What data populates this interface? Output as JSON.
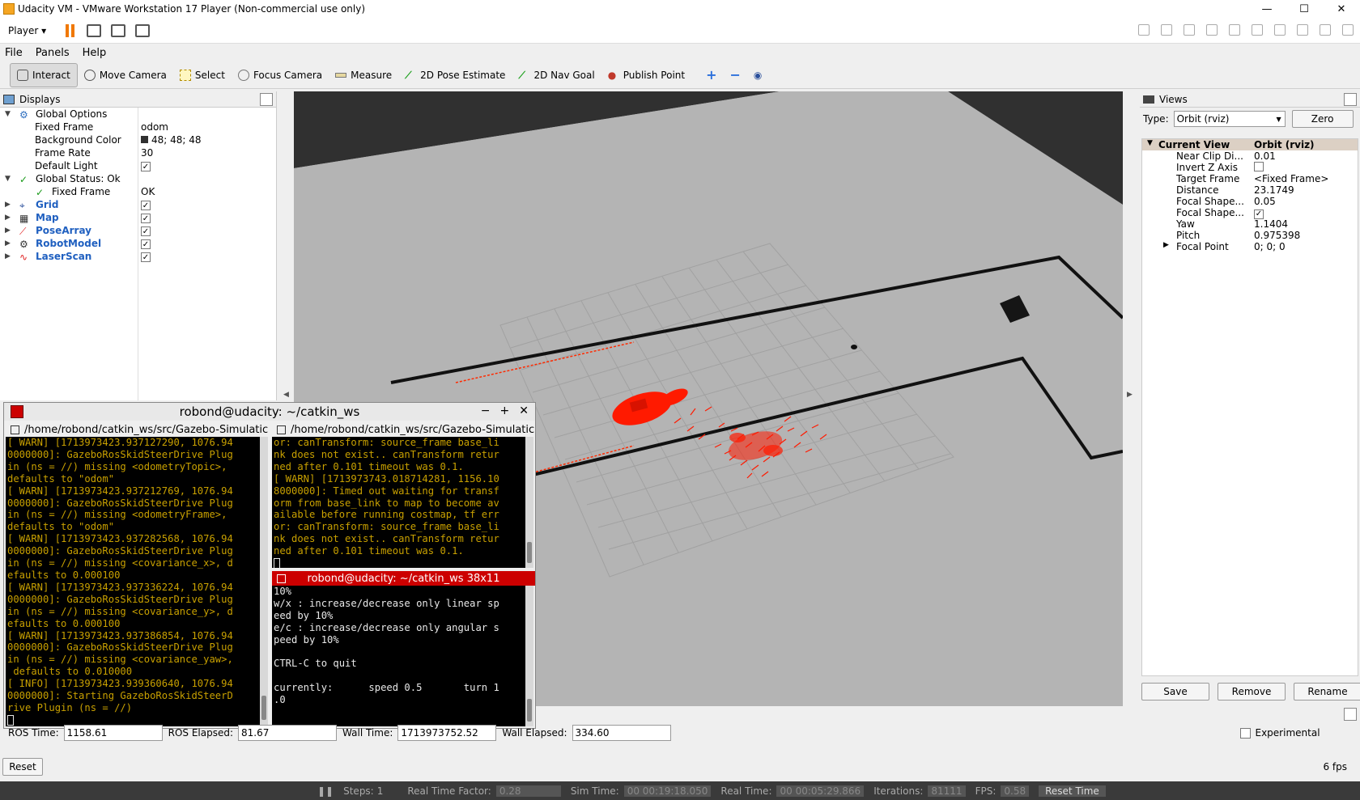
{
  "window": {
    "title": "Udacity VM - VMware Workstation 17 Player (Non-commercial use only)",
    "minimize": "—",
    "maximize": "☐",
    "close": "✕"
  },
  "vm_toolbar": {
    "player_label": "Player ▾"
  },
  "menubar": {
    "file": "File",
    "panels": "Panels",
    "help": "Help"
  },
  "tools": {
    "interact": "Interact",
    "move_camera": "Move Camera",
    "select": "Select",
    "focus_camera": "Focus Camera",
    "measure": "Measure",
    "pose_estimate": "2D Pose Estimate",
    "nav_goal": "2D Nav Goal",
    "publish_point": "Publish Point"
  },
  "displays": {
    "title": "Displays",
    "rows": [
      {
        "name": "Global Options",
        "value": ""
      },
      {
        "name": "Fixed Frame",
        "value": "odom"
      },
      {
        "name": "Background Color",
        "value": "48; 48; 48"
      },
      {
        "name": "Frame Rate",
        "value": "30"
      },
      {
        "name": "Default Light",
        "value": "✓"
      },
      {
        "name": "Global Status: Ok",
        "value": ""
      },
      {
        "name": "Fixed Frame",
        "value": "OK"
      },
      {
        "name": "Grid",
        "value": "✓"
      },
      {
        "name": "Map",
        "value": "✓"
      },
      {
        "name": "PoseArray",
        "value": "✓"
      },
      {
        "name": "RobotModel",
        "value": "✓"
      },
      {
        "name": "LaserScan",
        "value": "✓"
      }
    ]
  },
  "views": {
    "title": "Views",
    "type_label": "Type:",
    "type_value": "Orbit (rviz)",
    "zero_label": "Zero",
    "header_name": "Current View",
    "header_value": "Orbit (rviz)",
    "rows": [
      {
        "name": "Near Clip Di...",
        "value": "0.01"
      },
      {
        "name": "Invert Z Axis",
        "value": ""
      },
      {
        "name": "Target Frame",
        "value": "<Fixed Frame>"
      },
      {
        "name": "Distance",
        "value": "23.1749"
      },
      {
        "name": "Focal Shape...",
        "value": "0.05"
      },
      {
        "name": "Focal Shape...",
        "value": "✓"
      },
      {
        "name": "Yaw",
        "value": "1.1404"
      },
      {
        "name": "Pitch",
        "value": "0.975398"
      },
      {
        "name": "Focal Point",
        "value": "0; 0; 0"
      }
    ],
    "save": "Save",
    "remove": "Remove",
    "rename": "Rename"
  },
  "terminal": {
    "title": "robond@udacity: ~/catkin_ws",
    "left_tab": "/home/robond/catkin_ws/src/Gazebo-Simulatic",
    "right_tab": "/home/robond/catkin_ws/src/Gazebo-Simulatic",
    "left_lines": [
      "[ WARN] [1713973423.937127290, 1076.94",
      "0000000]: GazeboRosSkidSteerDrive Plug",
      "in (ns = //) missing <odometryTopic>,",
      "defaults to \"odom\"",
      "[ WARN] [1713973423.937212769, 1076.94",
      "0000000]: GazeboRosSkidSteerDrive Plug",
      "in (ns = //) missing <odometryFrame>,",
      "defaults to \"odom\"",
      "[ WARN] [1713973423.937282568, 1076.94",
      "0000000]: GazeboRosSkidSteerDrive Plug",
      "in (ns = //) missing <covariance_x>, d",
      "efaults to 0.000100",
      "[ WARN] [1713973423.937336224, 1076.94",
      "0000000]: GazeboRosSkidSteerDrive Plug",
      "in (ns = //) missing <covariance_y>, d",
      "efaults to 0.000100",
      "[ WARN] [1713973423.937386854, 1076.94",
      "0000000]: GazeboRosSkidSteerDrive Plug",
      "in (ns = //) missing <covariance_yaw>,",
      " defaults to 0.010000"
    ],
    "left_info_lines": [
      "[ INFO] [1713973423.939360640, 1076.94",
      "0000000]: Starting GazeboRosSkidSteerD",
      "rive Plugin (ns = //)"
    ],
    "right_top_lines": [
      "or: canTransform: source_frame base_li",
      "nk does not exist.. canTransform retur",
      "ned after 0.101 timeout was 0.1.",
      "[ WARN] [1713973743.018714281, 1156.10",
      "8000000]: Timed out waiting for transf",
      "orm from base_link to map to become av",
      "ailable before running costmap, tf err",
      "or: canTransform: source_frame base_li",
      "nk does not exist.. canTransform retur",
      "ned after 0.101 timeout was 0.1."
    ],
    "teleop_title": "robond@udacity: ~/catkin_ws 38x11",
    "right_bottom_lines": [
      "10%",
      "w/x : increase/decrease only linear sp",
      "eed by 10%",
      "e/c : increase/decrease only angular s",
      "peed by 10%",
      "",
      "CTRL-C to quit",
      "",
      "currently:      speed 0.5       turn 1",
      ".0"
    ]
  },
  "timebar": {
    "ros_time_label": "ROS Time:",
    "ros_time": "1158.61",
    "ros_elapsed_label": "ROS Elapsed:",
    "ros_elapsed": "81.67",
    "wall_time_label": "Wall Time:",
    "wall_time": "1713973752.52",
    "wall_elapsed_label": "Wall Elapsed:",
    "wall_elapsed": "334.60",
    "experimental": "Experimental",
    "reset": "Reset",
    "fps": "6 fps"
  },
  "gazebo_bar": {
    "steps_label": "Steps:",
    "steps": "1",
    "rtf_label": "Real Time Factor:",
    "rtf": "0.28",
    "sim_time_label": "Sim Time:",
    "sim_time": "00 00:19:18.050",
    "real_time_label": "Real Time:",
    "real_time": "00 00:05:29.866",
    "iterations_label": "Iterations:",
    "iterations": "81111",
    "fps_label": "FPS:",
    "fps": "0.58",
    "reset_time": "Reset Time"
  },
  "colors": {
    "accent_red": "#ff1a00",
    "teleop_bar": "#cc0000",
    "warn_yellow": "#c8a000"
  }
}
